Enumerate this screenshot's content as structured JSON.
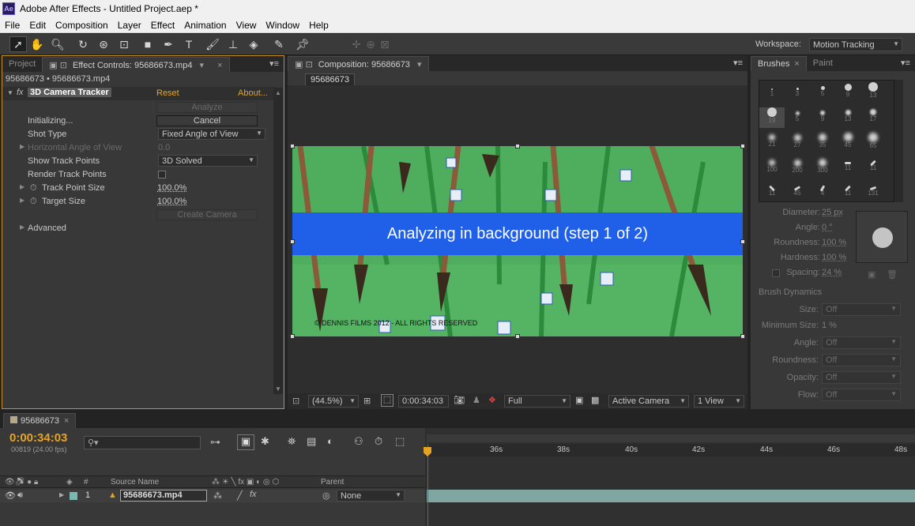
{
  "window": {
    "app_icon": "Ae",
    "title": "Adobe After Effects - Untitled Project.aep *"
  },
  "menu": [
    "File",
    "Edit",
    "Composition",
    "Layer",
    "Effect",
    "Animation",
    "View",
    "Window",
    "Help"
  ],
  "toolbar": {
    "workspace_label": "Workspace:",
    "workspace_value": "Motion Tracking"
  },
  "left_panel": {
    "tabs": [
      "Project",
      "Effect Controls: 95686673.mp4"
    ],
    "breadcrumb": "95686673 • 95686673.mp4",
    "effect_name": "3D Camera Tracker",
    "reset_label": "Reset",
    "about_label": "About...",
    "analyze_label": "Analyze",
    "status_label": "Initializing...",
    "cancel_label": "Cancel",
    "shot_type_label": "Shot Type",
    "shot_type_value": "Fixed Angle of View",
    "hangle_label": "Horizontal Angle of View",
    "hangle_value": "0.0",
    "show_tp_label": "Show Track Points",
    "show_tp_value": "3D Solved",
    "render_tp_label": "Render Track Points",
    "tp_size_label": "Track Point Size",
    "tp_size_value": "100.0%",
    "target_size_label": "Target Size",
    "target_size_value": "100.0%",
    "create_camera_label": "Create Camera",
    "advanced_label": "Advanced"
  },
  "comp_panel": {
    "tab": "Composition: 95686673",
    "comp_button": "95686673",
    "banner": "Analyzing in background (step 1 of 2)",
    "copyright": "© DENNIS FILMS 2012 - ALL RIGHTS RESERVED",
    "zoom": "(44.5%)",
    "timecode": "0:00:34:03",
    "resolution": "Full",
    "camera": "Active Camera",
    "views": "1 View"
  },
  "brushes_panel": {
    "tabs": [
      "Brushes",
      "Paint"
    ],
    "brush_sizes": [
      "1",
      "3",
      "5",
      "9",
      "13",
      "19",
      "5",
      "9",
      "13",
      "17",
      "21",
      "27",
      "35",
      "45",
      "65",
      "100",
      "200",
      "300",
      "11",
      "11",
      "11",
      "45",
      "4",
      "11",
      "131"
    ],
    "diameter_label": "Diameter:",
    "diameter_value": "25 px",
    "angle_label": "Angle:",
    "angle_value": "0 °",
    "roundness_label": "Roundness:",
    "roundness_value": "100 %",
    "hardness_label": "Hardness:",
    "hardness_value": "100 %",
    "spacing_label": "Spacing:",
    "spacing_value": "24 %",
    "dynamics_title": "Brush Dynamics",
    "dyn_size_label": "Size:",
    "dyn_size_value": "Off",
    "min_size_label": "Minimum Size:",
    "min_size_value": "1 %",
    "dyn_angle_label": "Angle:",
    "dyn_angle_value": "Off",
    "dyn_round_label": "Roundness:",
    "dyn_round_value": "Off",
    "dyn_opacity_label": "Opacity:",
    "dyn_opacity_value": "Off",
    "dyn_flow_label": "Flow:",
    "dyn_flow_value": "Off"
  },
  "timeline": {
    "tab": "95686673",
    "timecode": "0:00:34:03",
    "frames": "00819 (24.00 fps)",
    "search_placeholder": "",
    "col_num": "#",
    "col_source": "Source Name",
    "col_parent": "Parent",
    "ruler": [
      "36s",
      "38s",
      "40s",
      "42s",
      "44s",
      "46s",
      "48s"
    ],
    "layer_index": "1",
    "layer_name": "95686673.mp4",
    "parent_value": "None"
  }
}
